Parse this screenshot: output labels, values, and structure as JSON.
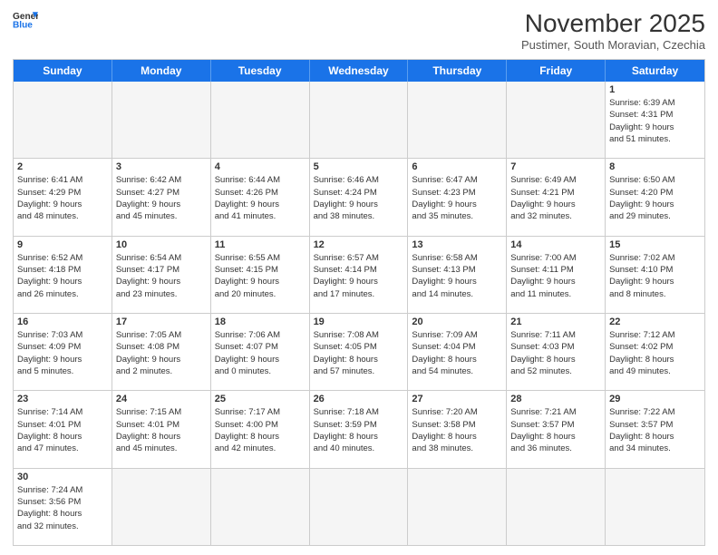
{
  "header": {
    "logo_general": "General",
    "logo_blue": "Blue",
    "month_title": "November 2025",
    "subtitle": "Pustimer, South Moravian, Czechia"
  },
  "day_headers": [
    "Sunday",
    "Monday",
    "Tuesday",
    "Wednesday",
    "Thursday",
    "Friday",
    "Saturday"
  ],
  "weeks": [
    [
      {
        "day": "",
        "info": ""
      },
      {
        "day": "",
        "info": ""
      },
      {
        "day": "",
        "info": ""
      },
      {
        "day": "",
        "info": ""
      },
      {
        "day": "",
        "info": ""
      },
      {
        "day": "",
        "info": ""
      },
      {
        "day": "1",
        "info": "Sunrise: 6:39 AM\nSunset: 4:31 PM\nDaylight: 9 hours\nand 51 minutes."
      }
    ],
    [
      {
        "day": "2",
        "info": "Sunrise: 6:41 AM\nSunset: 4:29 PM\nDaylight: 9 hours\nand 48 minutes."
      },
      {
        "day": "3",
        "info": "Sunrise: 6:42 AM\nSunset: 4:27 PM\nDaylight: 9 hours\nand 45 minutes."
      },
      {
        "day": "4",
        "info": "Sunrise: 6:44 AM\nSunset: 4:26 PM\nDaylight: 9 hours\nand 41 minutes."
      },
      {
        "day": "5",
        "info": "Sunrise: 6:46 AM\nSunset: 4:24 PM\nDaylight: 9 hours\nand 38 minutes."
      },
      {
        "day": "6",
        "info": "Sunrise: 6:47 AM\nSunset: 4:23 PM\nDaylight: 9 hours\nand 35 minutes."
      },
      {
        "day": "7",
        "info": "Sunrise: 6:49 AM\nSunset: 4:21 PM\nDaylight: 9 hours\nand 32 minutes."
      },
      {
        "day": "8",
        "info": "Sunrise: 6:50 AM\nSunset: 4:20 PM\nDaylight: 9 hours\nand 29 minutes."
      }
    ],
    [
      {
        "day": "9",
        "info": "Sunrise: 6:52 AM\nSunset: 4:18 PM\nDaylight: 9 hours\nand 26 minutes."
      },
      {
        "day": "10",
        "info": "Sunrise: 6:54 AM\nSunset: 4:17 PM\nDaylight: 9 hours\nand 23 minutes."
      },
      {
        "day": "11",
        "info": "Sunrise: 6:55 AM\nSunset: 4:15 PM\nDaylight: 9 hours\nand 20 minutes."
      },
      {
        "day": "12",
        "info": "Sunrise: 6:57 AM\nSunset: 4:14 PM\nDaylight: 9 hours\nand 17 minutes."
      },
      {
        "day": "13",
        "info": "Sunrise: 6:58 AM\nSunset: 4:13 PM\nDaylight: 9 hours\nand 14 minutes."
      },
      {
        "day": "14",
        "info": "Sunrise: 7:00 AM\nSunset: 4:11 PM\nDaylight: 9 hours\nand 11 minutes."
      },
      {
        "day": "15",
        "info": "Sunrise: 7:02 AM\nSunset: 4:10 PM\nDaylight: 9 hours\nand 8 minutes."
      }
    ],
    [
      {
        "day": "16",
        "info": "Sunrise: 7:03 AM\nSunset: 4:09 PM\nDaylight: 9 hours\nand 5 minutes."
      },
      {
        "day": "17",
        "info": "Sunrise: 7:05 AM\nSunset: 4:08 PM\nDaylight: 9 hours\nand 2 minutes."
      },
      {
        "day": "18",
        "info": "Sunrise: 7:06 AM\nSunset: 4:07 PM\nDaylight: 9 hours\nand 0 minutes."
      },
      {
        "day": "19",
        "info": "Sunrise: 7:08 AM\nSunset: 4:05 PM\nDaylight: 8 hours\nand 57 minutes."
      },
      {
        "day": "20",
        "info": "Sunrise: 7:09 AM\nSunset: 4:04 PM\nDaylight: 8 hours\nand 54 minutes."
      },
      {
        "day": "21",
        "info": "Sunrise: 7:11 AM\nSunset: 4:03 PM\nDaylight: 8 hours\nand 52 minutes."
      },
      {
        "day": "22",
        "info": "Sunrise: 7:12 AM\nSunset: 4:02 PM\nDaylight: 8 hours\nand 49 minutes."
      }
    ],
    [
      {
        "day": "23",
        "info": "Sunrise: 7:14 AM\nSunset: 4:01 PM\nDaylight: 8 hours\nand 47 minutes."
      },
      {
        "day": "24",
        "info": "Sunrise: 7:15 AM\nSunset: 4:01 PM\nDaylight: 8 hours\nand 45 minutes."
      },
      {
        "day": "25",
        "info": "Sunrise: 7:17 AM\nSunset: 4:00 PM\nDaylight: 8 hours\nand 42 minutes."
      },
      {
        "day": "26",
        "info": "Sunrise: 7:18 AM\nSunset: 3:59 PM\nDaylight: 8 hours\nand 40 minutes."
      },
      {
        "day": "27",
        "info": "Sunrise: 7:20 AM\nSunset: 3:58 PM\nDaylight: 8 hours\nand 38 minutes."
      },
      {
        "day": "28",
        "info": "Sunrise: 7:21 AM\nSunset: 3:57 PM\nDaylight: 8 hours\nand 36 minutes."
      },
      {
        "day": "29",
        "info": "Sunrise: 7:22 AM\nSunset: 3:57 PM\nDaylight: 8 hours\nand 34 minutes."
      }
    ],
    [
      {
        "day": "30",
        "info": "Sunrise: 7:24 AM\nSunset: 3:56 PM\nDaylight: 8 hours\nand 32 minutes."
      },
      {
        "day": "",
        "info": ""
      },
      {
        "day": "",
        "info": ""
      },
      {
        "day": "",
        "info": ""
      },
      {
        "day": "",
        "info": ""
      },
      {
        "day": "",
        "info": ""
      },
      {
        "day": "",
        "info": ""
      }
    ]
  ]
}
